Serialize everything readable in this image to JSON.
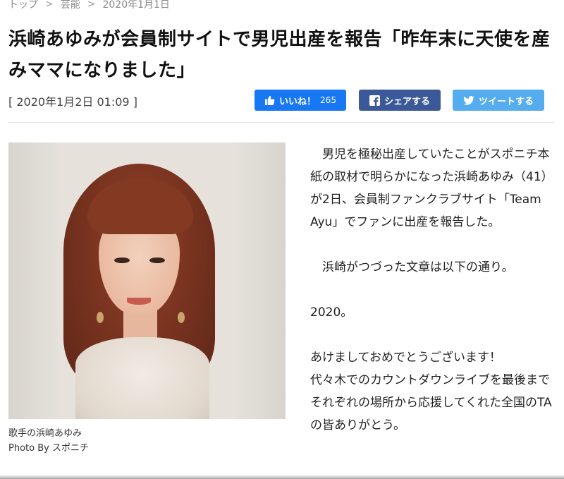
{
  "breadcrumb": {
    "items": [
      "トップ",
      "芸能",
      "2020年1月1日"
    ],
    "separator": ">"
  },
  "article": {
    "title": "浜崎あゆみが会員制サイトで男児出産を報告「昨年末に天使を産みママになりました」",
    "date": "[ 2020年1月2日 01:09 ]"
  },
  "share": {
    "like_label": "いいね！",
    "like_count": "265",
    "share_label": "シェアする",
    "tweet_label": "ツイートする",
    "colors": {
      "like": "#1877f2",
      "share": "#3b5998",
      "tweet": "#55acee"
    }
  },
  "photo": {
    "caption": "歌手の浜崎あゆみ",
    "credit": "Photo By スポニチ"
  },
  "body": {
    "paragraphs": [
      "男児を極秘出産していたことがスポニチ本紙の取材で明らかになった浜崎あゆみ（41）が2日、会員制ファンクラブサイト「Team　Ayu」でファンに出産を報告した。",
      "浜崎がつづった文章は以下の通り。",
      "2020。",
      "あけましておめでとうございます！\n代々木でのカウントダウンライブを最後までそれぞれの場所から応援してくれた全国のTAの皆ありがとう。"
    ]
  },
  "icons": [
    "thumbs-up-icon",
    "facebook-icon",
    "twitter-icon"
  ]
}
